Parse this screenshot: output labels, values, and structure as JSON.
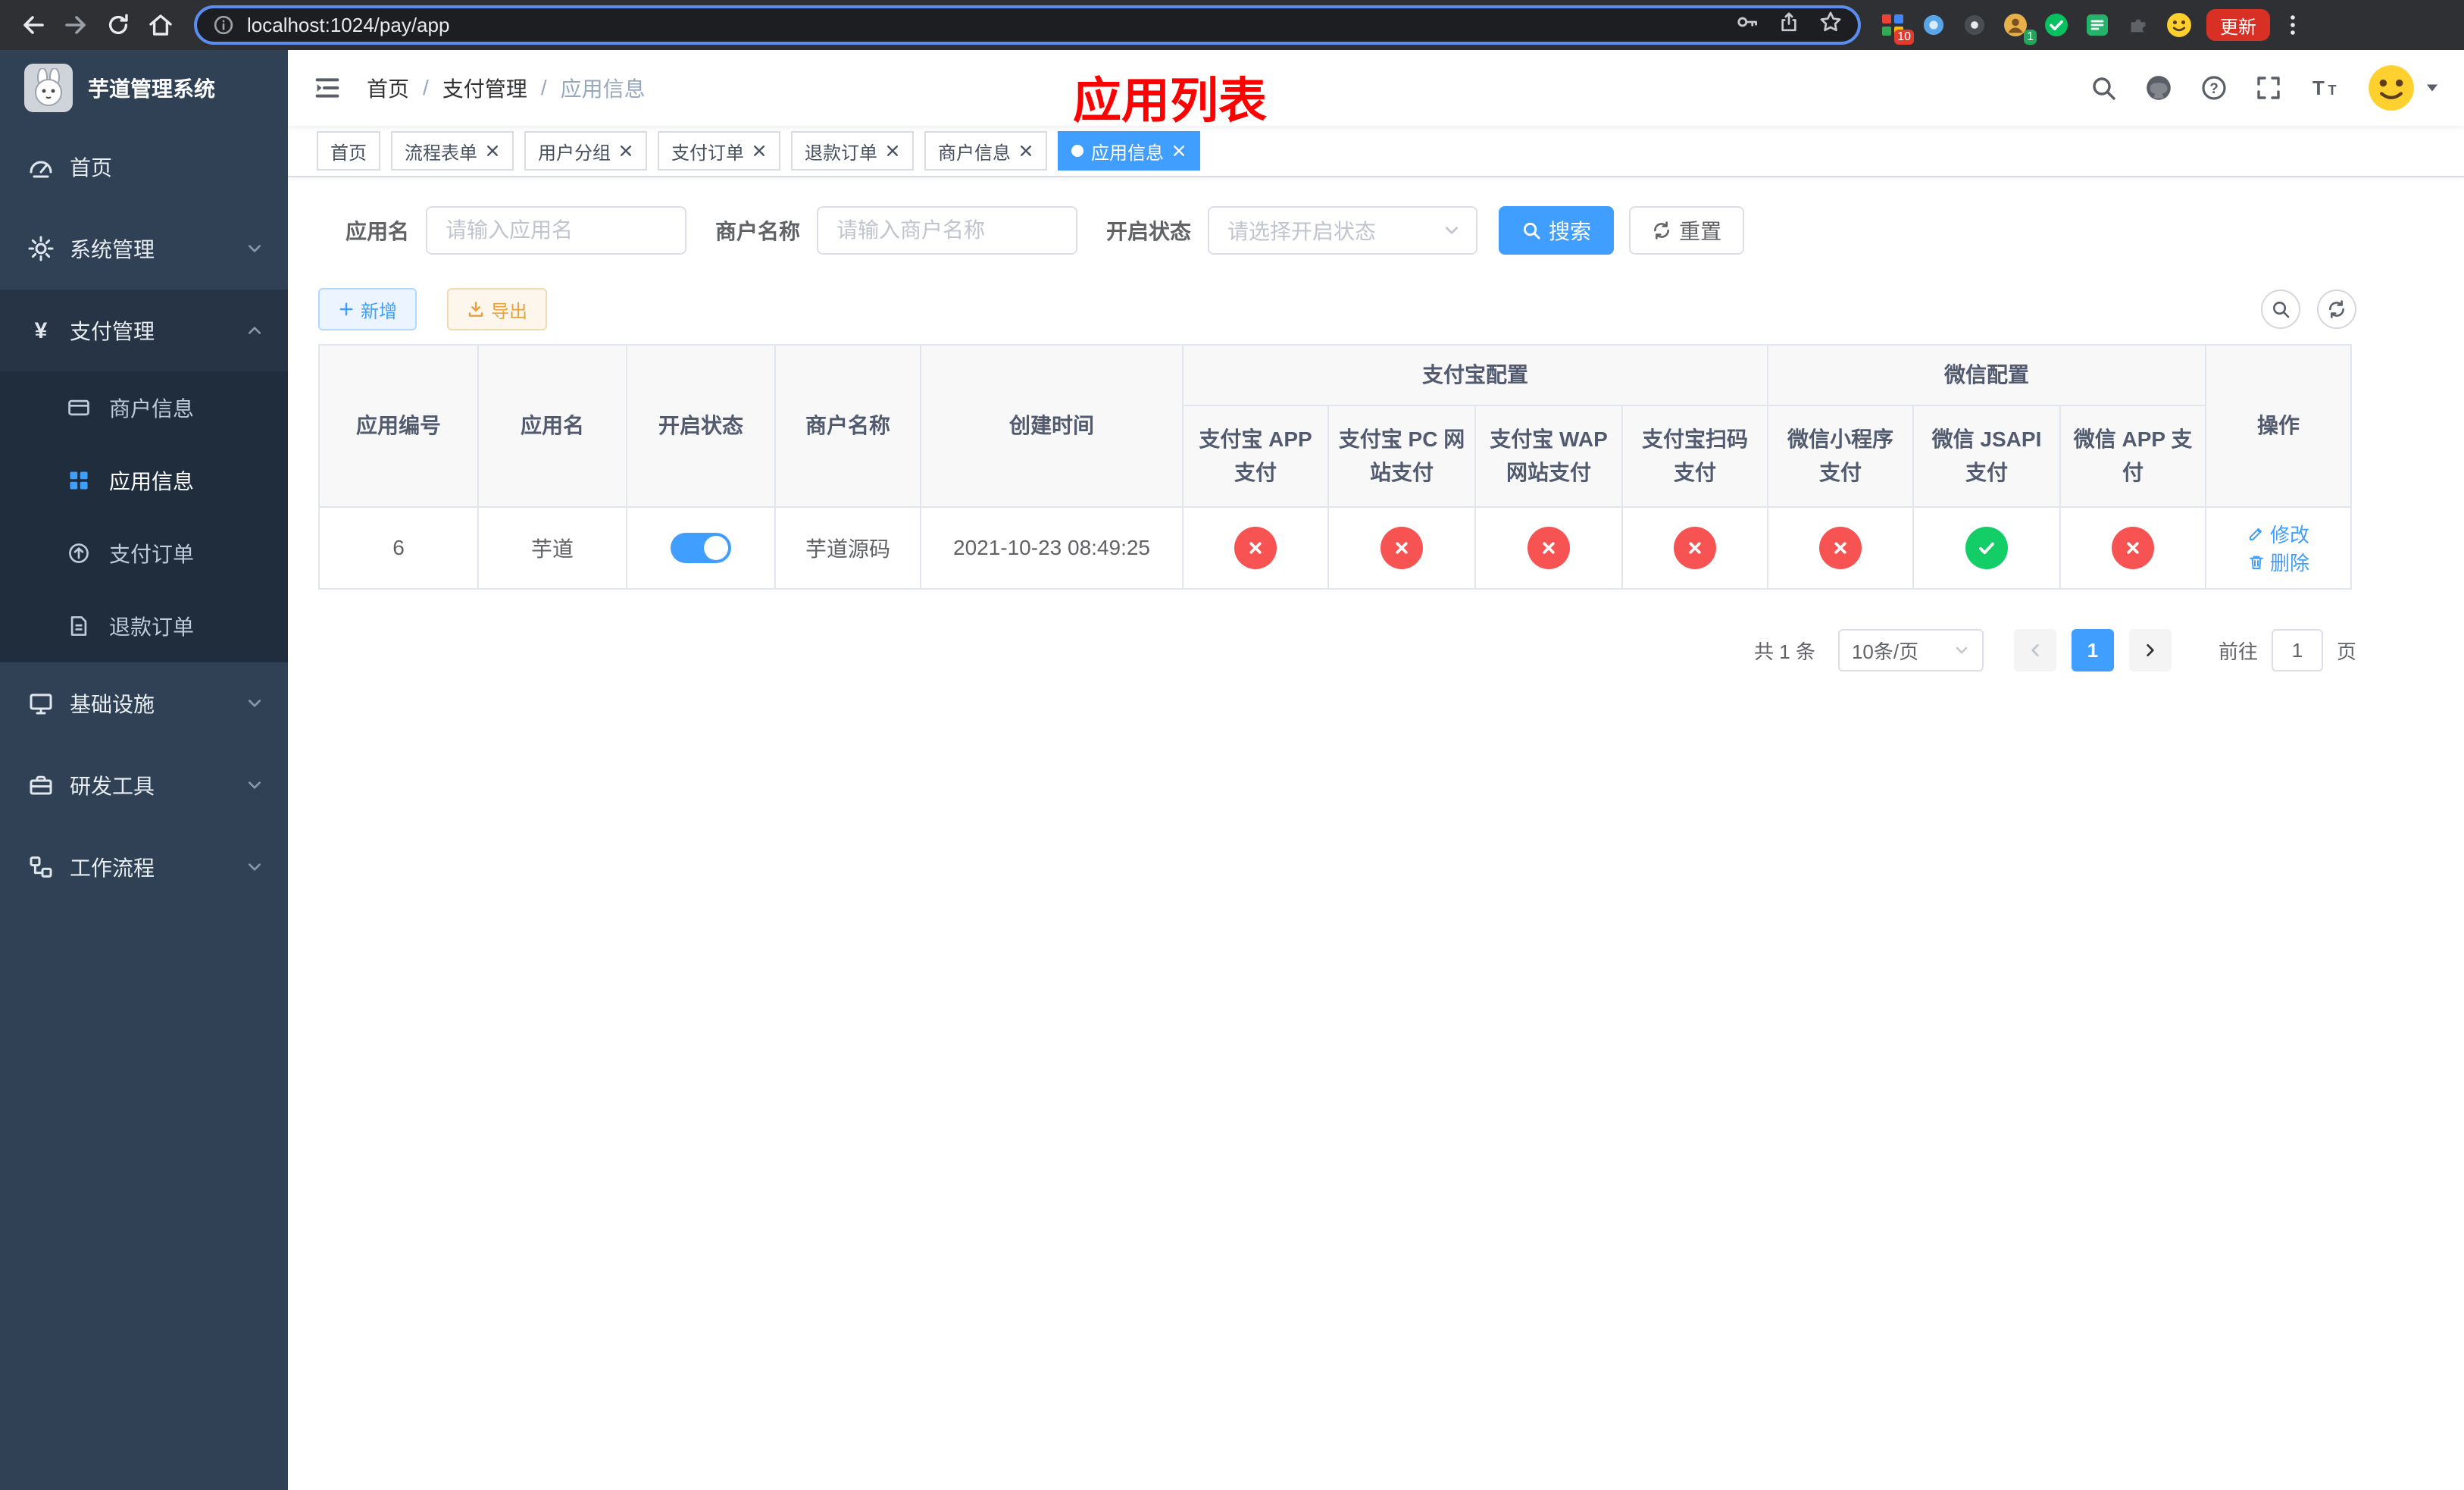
{
  "colors": {
    "primary": "#409eff",
    "success": "#13ce66",
    "danger": "#f75353",
    "warning": "#e6a23c",
    "sidebar_bg": "#304156",
    "submenu_bg": "#1f2d3d",
    "banner_red": "#ff0000"
  },
  "browser": {
    "url": "localhost:1024/pay/app",
    "update_button": "更新",
    "extension_badge_1": "10",
    "extension_badge_2": "1"
  },
  "sidebar": {
    "title": "芋道管理系统",
    "items": [
      {
        "label": "首页"
      },
      {
        "label": "系统管理"
      },
      {
        "label": "支付管理",
        "children": [
          {
            "label": "商户信息"
          },
          {
            "label": "应用信息"
          },
          {
            "label": "支付订单"
          },
          {
            "label": "退款订单"
          }
        ]
      },
      {
        "label": "基础设施"
      },
      {
        "label": "研发工具"
      },
      {
        "label": "工作流程"
      }
    ]
  },
  "navbar": {
    "breadcrumb": {
      "home": "首页",
      "section": "支付管理",
      "current": "应用信息",
      "separator": "/"
    },
    "banner": "应用列表"
  },
  "tabs": [
    {
      "label": "首页"
    },
    {
      "label": "流程表单"
    },
    {
      "label": "用户分组"
    },
    {
      "label": "支付订单"
    },
    {
      "label": "退款订单"
    },
    {
      "label": "商户信息"
    },
    {
      "label": "应用信息"
    }
  ],
  "filters": {
    "app_name": {
      "label": "应用名",
      "placeholder": "请输入应用名",
      "value": ""
    },
    "merchant_name": {
      "label": "商户名称",
      "placeholder": "请输入商户名称",
      "value": ""
    },
    "status": {
      "label": "开启状态",
      "placeholder": "请选择开启状态",
      "value": ""
    },
    "search": "搜索",
    "reset": "重置"
  },
  "toolbar": {
    "add": "新增",
    "export": "导出"
  },
  "table": {
    "main_columns": [
      "应用编号",
      "应用名",
      "开启状态",
      "商户名称",
      "创建时间"
    ],
    "groups": [
      {
        "label": "支付宝配置"
      },
      {
        "label": "微信配置"
      }
    ],
    "sub_columns": [
      "支付宝 APP 支付",
      "支付宝 PC 网站支付",
      "支付宝 WAP 网站支付",
      "支付宝扫码支付",
      "微信小程序支付",
      "微信 JSAPI 支付",
      "微信 APP 支付"
    ],
    "op_column": "操作",
    "rows": [
      {
        "id": "6",
        "name": "芋道",
        "enabled": true,
        "merchant": "芋道源码",
        "created": "2021-10-23 08:49:25",
        "statuses": [
          false,
          false,
          false,
          false,
          false,
          true,
          false
        ],
        "edit": "修改",
        "delete": "删除"
      }
    ]
  },
  "pagination": {
    "total": "共 1 条",
    "page_size": "10条/页",
    "page": "1",
    "goto": "前往",
    "page_unit": "页"
  }
}
